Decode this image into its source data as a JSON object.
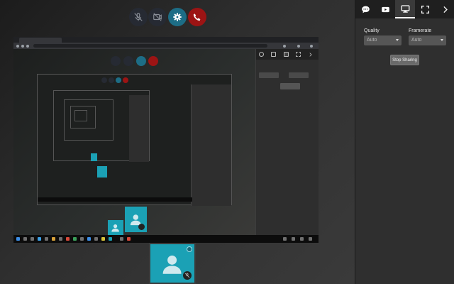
{
  "call_controls": {
    "mic_icon": "mic-muted-icon",
    "camera_icon": "camera-off-icon",
    "settings_icon": "gear-icon",
    "hangup_icon": "phone-hangup-icon"
  },
  "sidebar": {
    "tabs": [
      {
        "icon": "chat-icon",
        "active": false
      },
      {
        "icon": "youtube-icon",
        "active": false
      },
      {
        "icon": "screen-share-icon",
        "active": true
      },
      {
        "icon": "fullscreen-icon",
        "active": false
      },
      {
        "icon": "chevron-right-icon",
        "active": false
      }
    ],
    "quality_label": "Quality",
    "quality_value": "Auto",
    "framerate_label": "Framerate",
    "framerate_value": "Auto",
    "stop_sharing_label": "Stop Sharing"
  },
  "colors": {
    "settings_button": "#1d6d86",
    "hangup_button": "#9c1414",
    "tile_avatar": "#1ba1b5",
    "sidebar_bg": "#2f2f2f"
  }
}
